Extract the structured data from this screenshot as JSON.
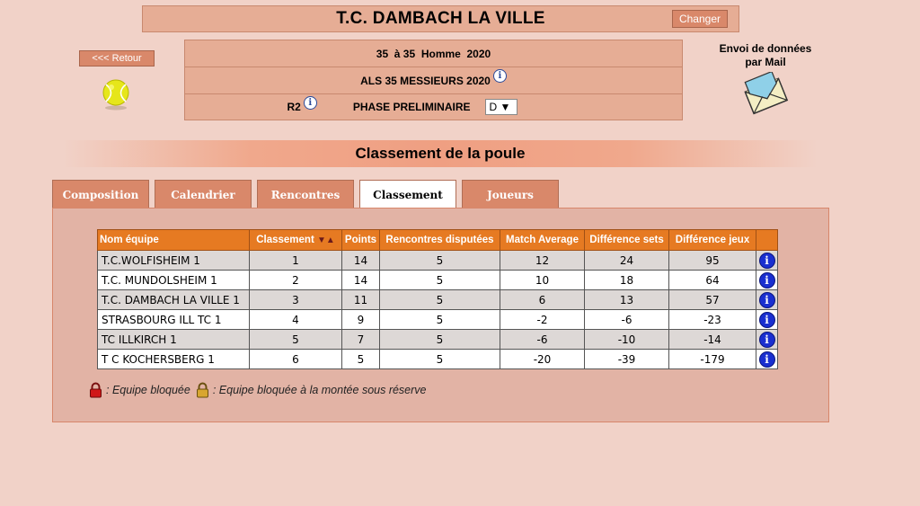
{
  "header": {
    "club_name": "T.C. DAMBACH LA VILLE",
    "change_label": "Changer",
    "back_label": "<<< Retour"
  },
  "info": {
    "line1": "35  à 35  Homme  2020",
    "line2": "ALS 35 MESSIEURS 2020",
    "division": "R2",
    "phase": "PHASE PRELIMINAIRE",
    "poule_selected": "D ▼",
    "info_icon_glyph": "i"
  },
  "mail": {
    "label_line1": "Envoi de données",
    "label_line2": "par Mail"
  },
  "section_title": "Classement de la poule",
  "tabs": [
    {
      "label": "Composition"
    },
    {
      "label": "Calendrier"
    },
    {
      "label": "Rencontres"
    },
    {
      "label": "Classement",
      "active": true
    },
    {
      "label": "Joueurs"
    }
  ],
  "table": {
    "headers": [
      "Nom équipe",
      "Classement",
      "Points",
      "Rencontres disputées",
      "Match Average",
      "Différence sets",
      "Différence jeux"
    ],
    "sort_arrows": "▼▲",
    "rows": [
      {
        "team": "T.C.WOLFISHEIM 1",
        "rank": "1",
        "points": "14",
        "played": "5",
        "avg": "12",
        "sets": "24",
        "games": "95"
      },
      {
        "team": "T.C. MUNDOLSHEIM 1",
        "rank": "2",
        "points": "14",
        "played": "5",
        "avg": "10",
        "sets": "18",
        "games": "64"
      },
      {
        "team": "T.C. DAMBACH LA VILLE 1",
        "rank": "3",
        "points": "11",
        "played": "5",
        "avg": "6",
        "sets": "13",
        "games": "57"
      },
      {
        "team": "STRASBOURG ILL TC 1",
        "rank": "4",
        "points": "9",
        "played": "5",
        "avg": "-2",
        "sets": "-6",
        "games": "-23"
      },
      {
        "team": "TC ILLKIRCH 1",
        "rank": "5",
        "points": "7",
        "played": "5",
        "avg": "-6",
        "sets": "-10",
        "games": "-14"
      },
      {
        "team": "T C KOCHERSBERG 1",
        "rank": "6",
        "points": "5",
        "played": "5",
        "avg": "-20",
        "sets": "-39",
        "games": "-179"
      }
    ]
  },
  "legend": {
    "locked": ": Equipe bloquée",
    "locked_promotion": ": Equipe bloquée à la montée sous réserve"
  },
  "colors": {
    "background": "#f1d2c8",
    "header_orange": "#e67a22",
    "tab_inactive": "#d9886a",
    "info_blue": "#1a2fd0"
  }
}
